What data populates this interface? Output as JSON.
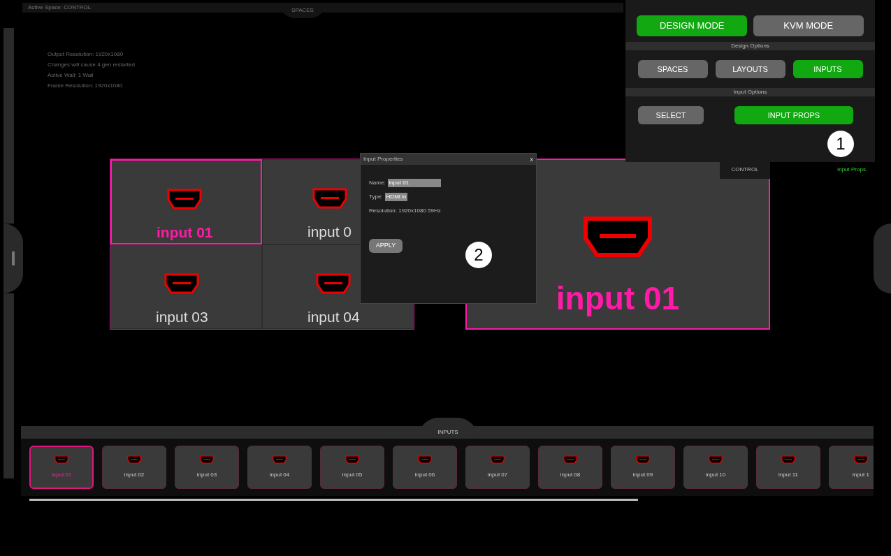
{
  "header": {
    "title": "Active Space: CONTROL",
    "tab": "SPACES"
  },
  "info_lines": [
    "Output Resolution: 1920x1080",
    "Changes will cause 4 gen restarted",
    "Active Wall: 1 Wall",
    "Frame Resolution: 1920x1080"
  ],
  "layouts": [
    {
      "kind": "grid",
      "cells": [
        {
          "label": "input 01",
          "selected": true
        },
        {
          "label": "input 0",
          "selected": false
        },
        {
          "label": "input 03",
          "selected": false
        },
        {
          "label": "input 04",
          "selected": false
        }
      ]
    },
    {
      "kind": "single",
      "label": "input 01",
      "selected": true
    }
  ],
  "control_panel": {
    "modes": [
      {
        "label": "DESIGN MODE",
        "selected": true
      },
      {
        "label": "KVM MODE",
        "selected": false
      }
    ],
    "design_options_title": "Design Options",
    "design_options": [
      {
        "label": "SPACES",
        "selected": false
      },
      {
        "label": "LAYOUTS",
        "selected": false
      },
      {
        "label": "INPUTS",
        "selected": true
      }
    ],
    "input_options_title": "Input Options",
    "input_options": [
      {
        "label": "SELECT",
        "selected": false
      },
      {
        "label": "INPUT PROPS",
        "selected": true
      }
    ],
    "tab": "CONTROL",
    "status": "Input Props"
  },
  "dialog": {
    "title": "Input Properties",
    "close": "x",
    "fields": [
      {
        "label": "Name:",
        "value": "input 01"
      },
      {
        "label": "Type:",
        "value": "HDMI in"
      }
    ],
    "resolution": "Resolution: 1920x1080 59Hz",
    "button": "APPLY"
  },
  "inputs_bar": {
    "title": "INPUTS",
    "items": [
      {
        "label": "input 01",
        "selected": true
      },
      {
        "label": "input 02",
        "selected": false
      },
      {
        "label": "input 03",
        "selected": false
      },
      {
        "label": "input 04",
        "selected": false
      },
      {
        "label": "input 05",
        "selected": false
      },
      {
        "label": "input 06",
        "selected": false
      },
      {
        "label": "input 07",
        "selected": false
      },
      {
        "label": "input 08",
        "selected": false
      },
      {
        "label": "input 09",
        "selected": false
      },
      {
        "label": "input 10",
        "selected": false
      },
      {
        "label": "input 11",
        "selected": false
      },
      {
        "label": "input 1",
        "selected": false
      }
    ]
  },
  "callouts": [
    "1",
    "2"
  ]
}
